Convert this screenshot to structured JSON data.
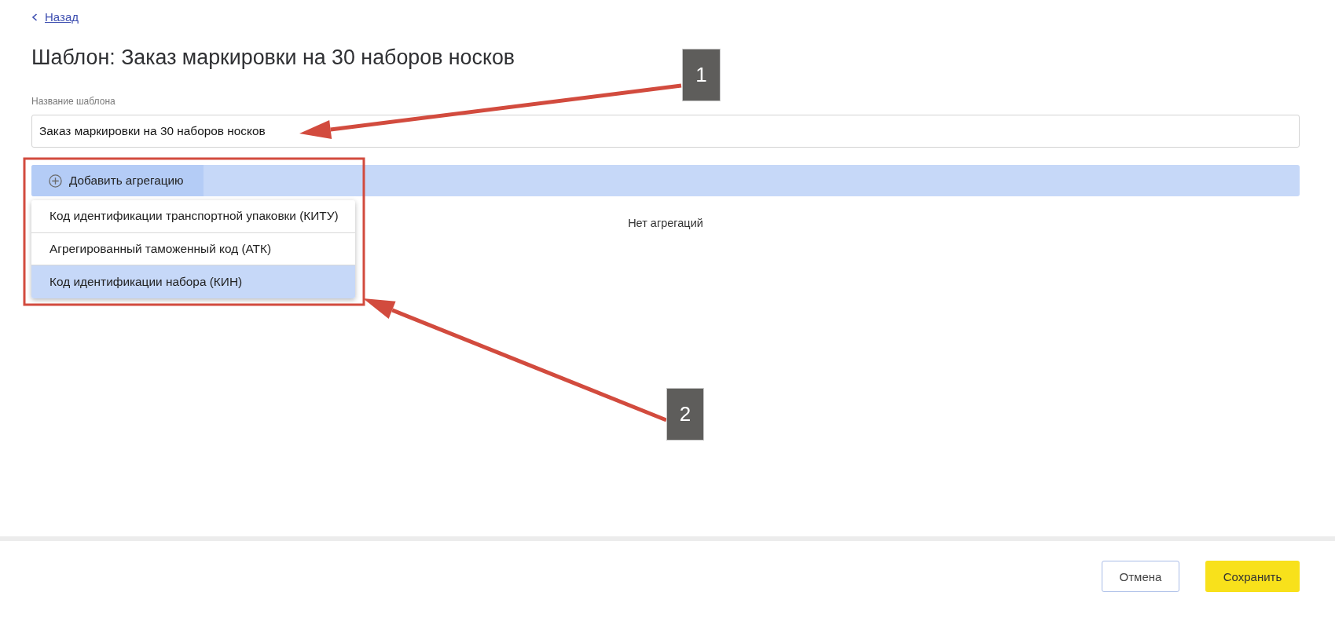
{
  "back_link": {
    "label": "Назад"
  },
  "title": "Шаблон: Заказ маркировки на 30 наборов носков",
  "template_name_field": {
    "label": "Название шаблона",
    "value": "Заказ маркировки на 30 наборов носков"
  },
  "aggregations": {
    "add_button": "Добавить агрегацию",
    "menu": [
      {
        "label": "Код идентификации транспортной упаковки (КИТУ)",
        "selected": false
      },
      {
        "label": "Агрегированный таможенный код (АТК)",
        "selected": false
      },
      {
        "label": "Код идентификации набора (КИН)",
        "selected": true
      }
    ],
    "empty_message": "Нет агрегаций"
  },
  "footer": {
    "buttons": [
      {
        "label": "Отмена",
        "kind": "secondary"
      },
      {
        "label": "Сохранить",
        "kind": "primary"
      }
    ]
  },
  "annotations": [
    {
      "kind": "callout",
      "label": "1"
    },
    {
      "kind": "frame"
    },
    {
      "kind": "callout",
      "label": "2"
    }
  ]
}
